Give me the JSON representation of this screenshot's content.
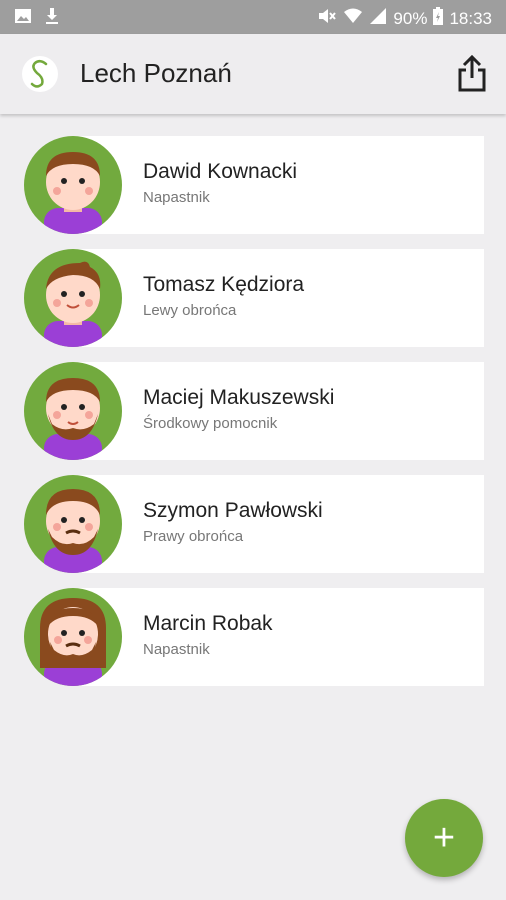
{
  "status_bar": {
    "icons_left": [
      "image-icon",
      "download-icon"
    ],
    "icons_right": [
      "mute-icon",
      "wifi-icon",
      "signal-icon"
    ],
    "battery": "90%",
    "time": "18:33"
  },
  "app_bar": {
    "logo_letter": "S",
    "title": "Lech Poznań",
    "action_icon": "share-icon"
  },
  "players": [
    {
      "name": "Dawid Kownacki",
      "position": "Napastnik"
    },
    {
      "name": "Tomasz Kędziora",
      "position": "Lewy obrońca"
    },
    {
      "name": "Maciej Makuszewski",
      "position": "Środkowy pomocnik"
    },
    {
      "name": "Szymon Pawłowski",
      "position": "Prawy obrońca"
    },
    {
      "name": "Marcin Robak",
      "position": "Napastnik"
    }
  ],
  "fab": {
    "label": "+"
  },
  "colors": {
    "accent": "#74a93c",
    "status_bar": "#9e9e9e",
    "background": "#efeef0",
    "shirt": "#9b3fd6"
  }
}
